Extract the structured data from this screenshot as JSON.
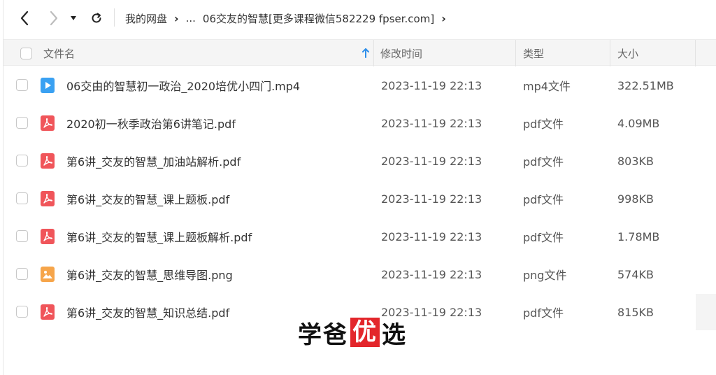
{
  "navigation": {
    "back_icon": "chevron-left-icon",
    "forward_icon": "chevron-right-icon",
    "history_icon": "caret-down-icon",
    "refresh_icon": "refresh-icon"
  },
  "breadcrumb": {
    "root": "我的网盘",
    "ellipsis": "...",
    "current": "06交友的智慧[更多课程微信582229 fpser.com]"
  },
  "table": {
    "headers": {
      "name": "文件名",
      "modified": "修改时间",
      "type": "类型",
      "size": "大小"
    },
    "sort_icon": "arrow-up-icon",
    "rows": [
      {
        "name": "06交由的智慧初一政治_2020培优小四门.mp4",
        "modified": "2023-11-19 22:13",
        "type": "mp4文件",
        "size": "322.51MB",
        "icon": "video-file-icon"
      },
      {
        "name": "2020初一秋季政治第6讲笔记.pdf",
        "modified": "2023-11-19 22:13",
        "type": "pdf文件",
        "size": "4.09MB",
        "icon": "pdf-file-icon"
      },
      {
        "name": "第6讲_交友的智慧_加油站解析.pdf",
        "modified": "2023-11-19 22:13",
        "type": "pdf文件",
        "size": "803KB",
        "icon": "pdf-file-icon"
      },
      {
        "name": "第6讲_交友的智慧_课上题板.pdf",
        "modified": "2023-11-19 22:13",
        "type": "pdf文件",
        "size": "998KB",
        "icon": "pdf-file-icon"
      },
      {
        "name": "第6讲_交友的智慧_课上题板解析.pdf",
        "modified": "2023-11-19 22:13",
        "type": "pdf文件",
        "size": "1.78MB",
        "icon": "pdf-file-icon"
      },
      {
        "name": "第6讲_交友的智慧_思维导图.png",
        "modified": "2023-11-19 22:13",
        "type": "png文件",
        "size": "574KB",
        "icon": "image-file-icon"
      },
      {
        "name": "第6讲_交友的智慧_知识总结.pdf",
        "modified": "2023-11-19 22:13",
        "type": "pdf文件",
        "size": "815KB",
        "icon": "pdf-file-icon"
      }
    ]
  },
  "watermark": {
    "part1": "学爸",
    "part2": "优",
    "part3": "选"
  },
  "colors": {
    "pdf": "#f0555a",
    "video": "#3aa1f2",
    "image": "#f6a54a",
    "sort_arrow": "#2f8fea",
    "watermark_red": "#e3262b"
  }
}
